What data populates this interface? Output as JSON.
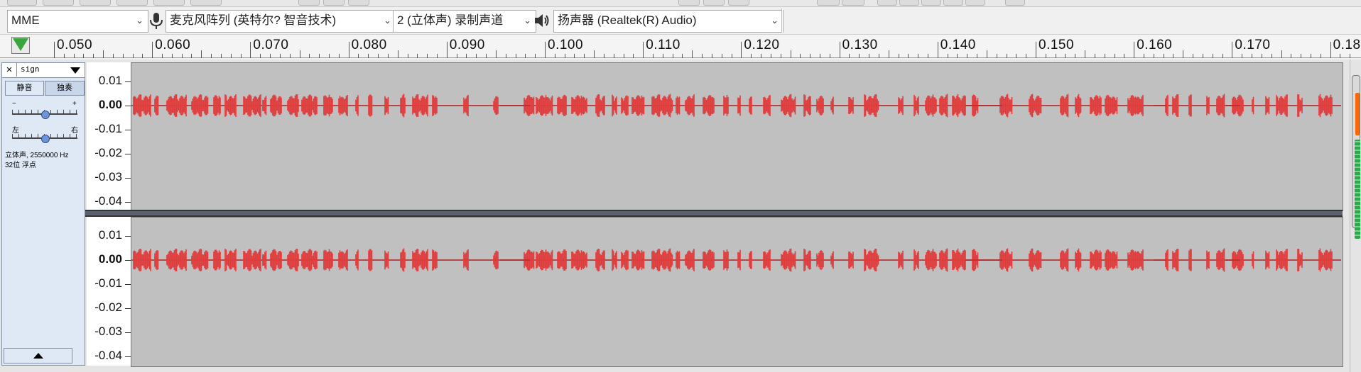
{
  "device_toolbar": {
    "host": "MME",
    "recording_device": "麦克风阵列 (英特尔? 智音技术)",
    "recording_channels": "2 (立体声) 录制声道",
    "playback_device": "扬声器 (Realtek(R) Audio)"
  },
  "ruler": {
    "labels": [
      "0.050",
      "0.060",
      "0.070",
      "0.080",
      "0.090",
      "0.100",
      "0.110",
      "0.120",
      "0.130",
      "0.140",
      "0.150",
      "0.160",
      "0.170",
      "0.180"
    ]
  },
  "track": {
    "name": "sign",
    "close_label": "×",
    "mute_label": "静音",
    "solo_label": "独奏",
    "gain_minus": "−",
    "gain_plus": "+",
    "pan_left": "左",
    "pan_right": "右",
    "info_line1": "立体声, 2550000 Hz",
    "info_line2": "32位 浮点"
  },
  "vertical_ruler": {
    "labels": [
      "0.01",
      "0.00",
      "-0.01",
      "-0.02",
      "-0.03",
      "-0.04"
    ]
  },
  "colors": {
    "waveform": "#e03c3c",
    "waveform_dark": "#b01e1e",
    "track_bg": "#c0c0c0",
    "panel_bg": "#dfe8f5"
  },
  "icons": {
    "mic": "microphone-icon",
    "speaker": "speaker-icon",
    "play_marker": "play-head-icon"
  }
}
